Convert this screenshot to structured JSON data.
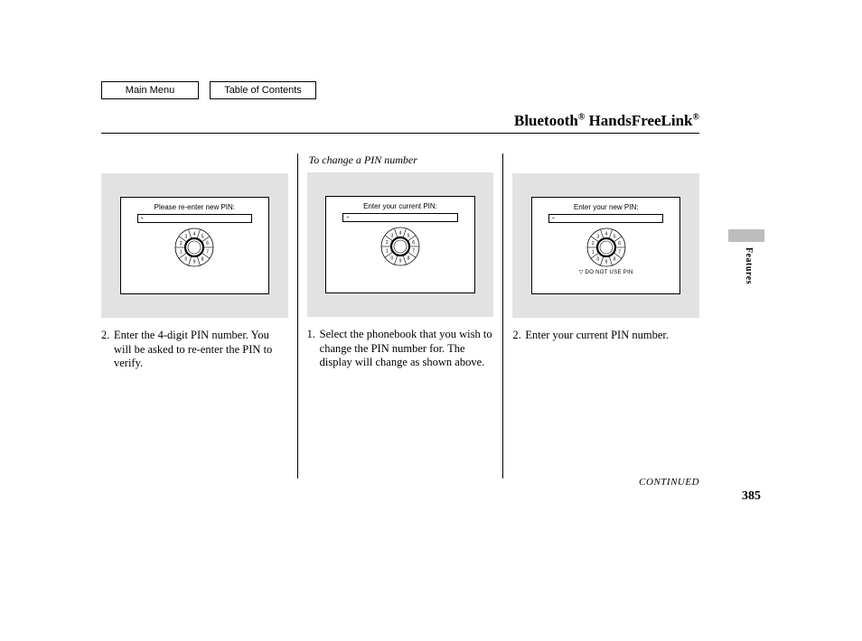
{
  "nav": {
    "main_menu": "Main Menu",
    "toc": "Table of Contents"
  },
  "title": {
    "pre": "Bluetooth",
    "reg1": "®",
    "mid": " HandsFreeLink",
    "reg2": "®"
  },
  "side_tab_label": "Features",
  "columns": {
    "col1": {
      "screen_label": "Please re-enter new PIN:",
      "step_num": "2.",
      "step_text": "Enter the 4-digit PIN number. You will be asked to re-enter the PIN to verify."
    },
    "col2": {
      "heading": "To change a PIN number",
      "screen_label": "Enter your current PIN:",
      "step_num": "1.",
      "step_text": "Select the phonebook that you wish to change the PIN number for. The display will change as shown above."
    },
    "col3": {
      "screen_label": "Enter your new PIN:",
      "screen_note": "▽ DO NOT USE PIN",
      "step_num": "2.",
      "step_text": "Enter your current PIN number."
    }
  },
  "continued": "CONTINUED",
  "page_number": "385",
  "dial_chars": [
    "4",
    "5",
    "6",
    "7",
    "8",
    "9",
    "0",
    "1",
    "2",
    "3"
  ]
}
